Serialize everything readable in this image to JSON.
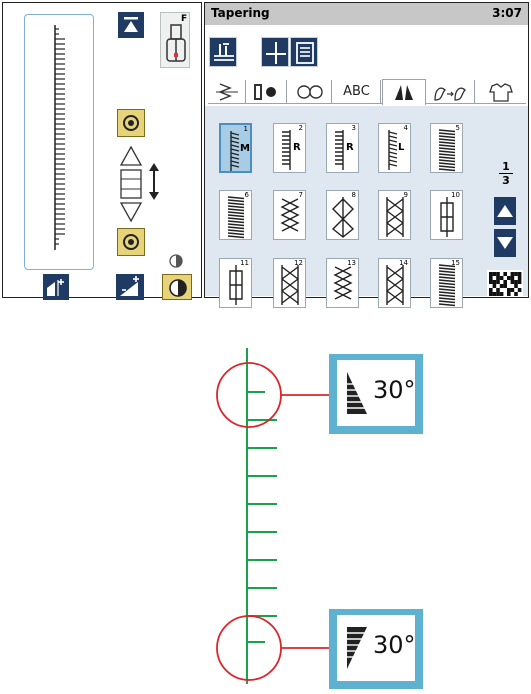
{
  "left_panel": {
    "presser_foot_letter": "F"
  },
  "title_bar": {
    "title": "Tapering",
    "time": "3:07"
  },
  "tabs": [
    {
      "icon": "utility-stitch-icon"
    },
    {
      "icon": "buttonhole-icon"
    },
    {
      "icon": "decorative-stitch-icon"
    },
    {
      "label": "ABC"
    },
    {
      "icon": "tapering-stitch-icon",
      "selected": true
    },
    {
      "icon": "floral-stitch-icon"
    },
    {
      "icon": "garment-icon"
    }
  ],
  "stitches": [
    {
      "num": "1",
      "letter": "M"
    },
    {
      "num": "2",
      "letter": "R"
    },
    {
      "num": "3",
      "letter": "R"
    },
    {
      "num": "4",
      "letter": "L"
    },
    {
      "num": "5",
      "letter": ""
    },
    {
      "num": "6",
      "letter": ""
    },
    {
      "num": "7",
      "letter": ""
    },
    {
      "num": "8",
      "letter": ""
    },
    {
      "num": "9",
      "letter": ""
    },
    {
      "num": "10",
      "letter": ""
    },
    {
      "num": "11",
      "letter": ""
    },
    {
      "num": "12",
      "letter": ""
    },
    {
      "num": "13",
      "letter": ""
    },
    {
      "num": "14",
      "letter": ""
    },
    {
      "num": "15",
      "letter": ""
    }
  ],
  "pager": {
    "current": "1",
    "total": "3"
  },
  "callouts": [
    {
      "angle": "30°"
    },
    {
      "angle": "30°"
    }
  ],
  "colors": {
    "navy": "#1f3b63",
    "yellow_button": "#e6d37a",
    "selected_stitch": "#a7cce5",
    "callout_border": "#5fb2cf",
    "stitch_line": "#1aa24a",
    "callout_circle": "#d9262c"
  }
}
